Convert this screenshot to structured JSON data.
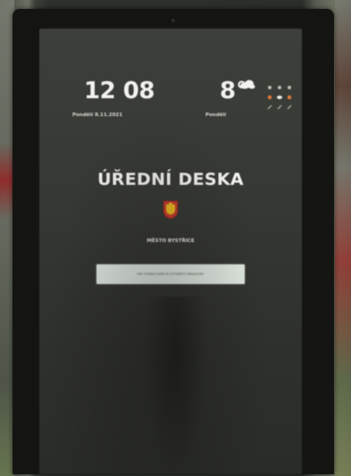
{
  "kiosk": {
    "clock": "12 08",
    "date_left": "Pondělí 8.11.2021",
    "temperature": "8°",
    "date_right": "Pondělí",
    "title": "ÚŘEDNÍ DESKA",
    "town": "MĚSTO BYSTŘICE",
    "notice_text": "PRO POKRAČOVÁNÍ SE DOTKNĚTE OBRAZOVKY",
    "weather_icon": "partly-cloudy-icon",
    "crest_icon": "town-crest-icon"
  },
  "colors": {
    "screen_bg": "#363834",
    "text": "#f2f2ee",
    "notice_bg": "#e3ebe3",
    "crest_red": "#c23a2e",
    "crest_yellow": "#e8b820",
    "forecast_orange": "#e27a3a"
  }
}
